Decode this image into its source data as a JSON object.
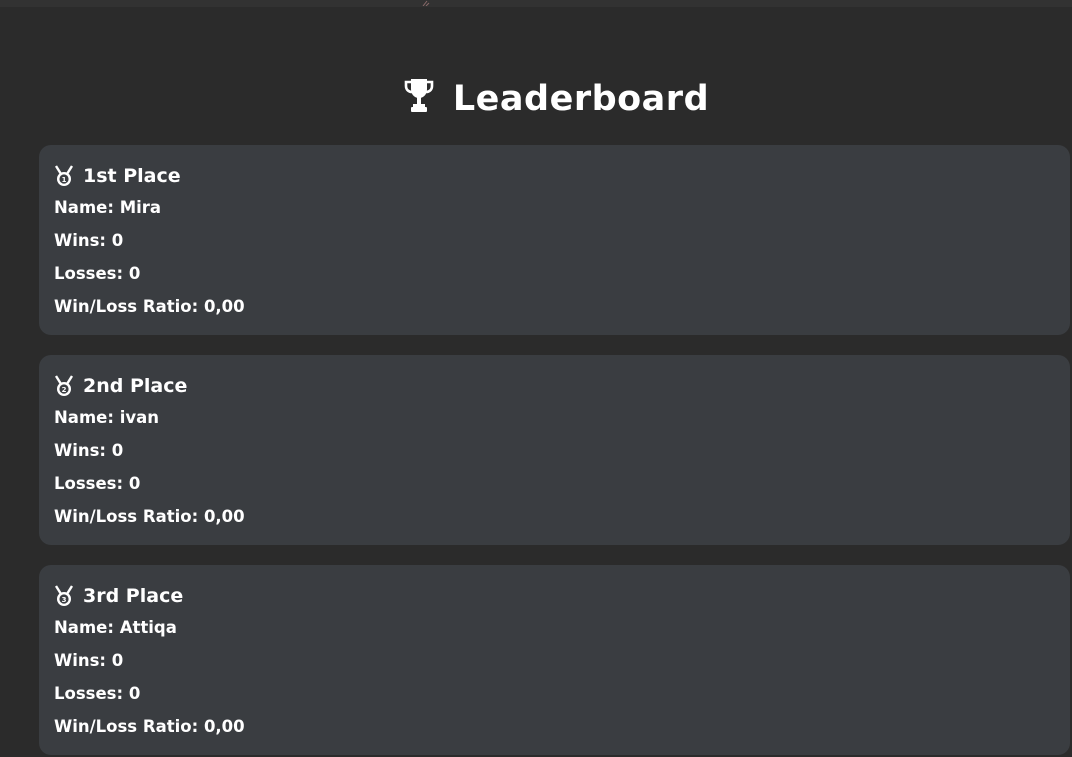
{
  "title": "Leaderboard",
  "title_icon": "trophy-icon",
  "colors": {
    "background": "#2b2b2b",
    "card": "#3a3d41",
    "text": "#ffffff"
  },
  "labels": {
    "name": "Name:",
    "wins": "Wins:",
    "losses": "Losses:",
    "ratio": "Win/Loss Ratio:"
  },
  "entries": [
    {
      "place": "1st Place",
      "medal_icon": "medal-1-icon",
      "name": "Mira",
      "wins": "0",
      "losses": "0",
      "ratio": "0,00"
    },
    {
      "place": "2nd Place",
      "medal_icon": "medal-2-icon",
      "name": "ivan",
      "wins": "0",
      "losses": "0",
      "ratio": "0,00"
    },
    {
      "place": "3rd Place",
      "medal_icon": "medal-3-icon",
      "name": "Attiqa",
      "wins": "0",
      "losses": "0",
      "ratio": "0,00"
    }
  ]
}
